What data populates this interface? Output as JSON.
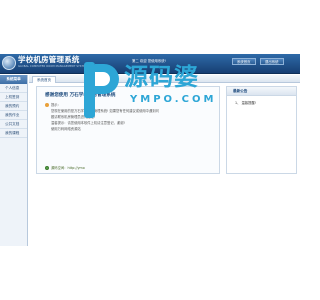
{
  "header": {
    "title": "学校机房管理系统",
    "subtitle": "GLOBAL COMPUTER ROOM MANAGEMENT SYSTEM",
    "welcome": "第二 欢迎 您使用系统!",
    "home_label": "系统首页",
    "logout_label": "退出系统"
  },
  "sidebar": {
    "heading": "系统菜单",
    "items": [
      {
        "label": "个人信息"
      },
      {
        "label": "上机签到"
      },
      {
        "label": "我的预约"
      },
      {
        "label": "我的作业"
      },
      {
        "label": "公共文档"
      },
      {
        "label": "我的课程"
      }
    ]
  },
  "tabs": [
    {
      "label": "系统首页"
    }
  ],
  "welcome_panel": {
    "title": "感谢您使用 万石学校机房管理系统",
    "tip_label": "提示：",
    "line1": "您现在使用的是万石学校机房管理系统! 如果您有任何建议或使用中遇到问",
    "line2": "题请联系机房管理员进行处理!",
    "line3": "温馨提示：请您使用本软件上机请注意登记，谢谢!",
    "line4": "使用万码网络资源站",
    "footer": "源码空间：http://ymo"
  },
  "notice": {
    "heading": "最新公告",
    "items": [
      {
        "label": "1、 温馨提醒!"
      }
    ]
  },
  "watermark": {
    "text": "源码婆",
    "sub": "YMPO.COM"
  }
}
